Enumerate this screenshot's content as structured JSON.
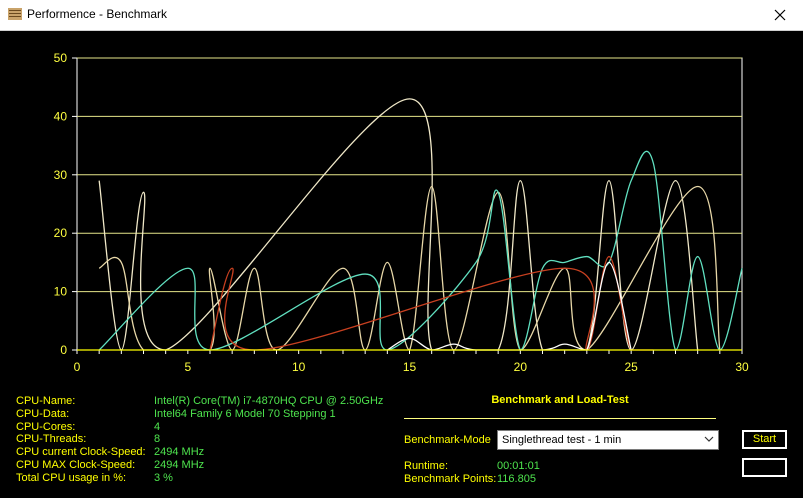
{
  "window": {
    "title": "Performence - Benchmark"
  },
  "chart_data": {
    "type": "line",
    "xlim": [
      0,
      30
    ],
    "ylim": [
      0,
      50
    ],
    "x_ticks": [
      0,
      5,
      10,
      15,
      20,
      25,
      30
    ],
    "y_ticks": [
      0,
      10,
      20,
      30,
      40,
      50
    ],
    "grid": "horizontal",
    "series": [
      {
        "color": "#f0e8c8",
        "points": [
          [
            1,
            29
          ],
          [
            2,
            0
          ],
          [
            3,
            27
          ],
          [
            4,
            0
          ],
          [
            15,
            43
          ],
          [
            16,
            0
          ],
          [
            19,
            0
          ],
          [
            20,
            29
          ],
          [
            21,
            0
          ],
          [
            23,
            0
          ],
          [
            24,
            29
          ],
          [
            25,
            0
          ],
          [
            27,
            29
          ],
          [
            28,
            0
          ]
        ]
      },
      {
        "color": "#e8d8a8",
        "points": [
          [
            1,
            14
          ],
          [
            2,
            15
          ],
          [
            3,
            0
          ],
          [
            6,
            0
          ],
          [
            6,
            14
          ],
          [
            7,
            0
          ],
          [
            8,
            14
          ],
          [
            9,
            0
          ],
          [
            12,
            14
          ],
          [
            13,
            0
          ],
          [
            14,
            15
          ],
          [
            15,
            0
          ],
          [
            16,
            28
          ],
          [
            17,
            0
          ],
          [
            19,
            27
          ],
          [
            20,
            0
          ],
          [
            22,
            14
          ],
          [
            23,
            0
          ],
          [
            28,
            28
          ],
          [
            29,
            0
          ]
        ]
      },
      {
        "color": "#60e0c0",
        "points": [
          [
            1,
            0
          ],
          [
            5,
            14
          ],
          [
            6,
            0
          ],
          [
            13,
            13
          ],
          [
            14,
            0
          ],
          [
            18,
            15
          ],
          [
            19,
            27
          ],
          [
            20,
            0
          ],
          [
            21,
            14
          ],
          [
            22,
            15
          ],
          [
            23,
            16
          ],
          [
            24,
            15
          ],
          [
            25,
            29
          ],
          [
            26,
            32
          ],
          [
            27,
            0
          ],
          [
            28,
            16
          ],
          [
            29,
            0
          ],
          [
            30,
            14
          ]
        ]
      },
      {
        "color": "#c84020",
        "points": [
          [
            6,
            0
          ],
          [
            7,
            14
          ],
          [
            8,
            0
          ],
          [
            22,
            14
          ],
          [
            23,
            0
          ],
          [
            24,
            16
          ],
          [
            25,
            0
          ],
          [
            26,
            0
          ]
        ]
      },
      {
        "color": "#ffffff",
        "points": [
          [
            14,
            0
          ],
          [
            15,
            2
          ],
          [
            16,
            0
          ],
          [
            17,
            1
          ],
          [
            18,
            0
          ],
          [
            21,
            0
          ],
          [
            22,
            1
          ],
          [
            23,
            0
          ],
          [
            24,
            15
          ],
          [
            25,
            0
          ]
        ]
      },
      {
        "color": "#ffff00",
        "points": [
          [
            0,
            0
          ],
          [
            30,
            0
          ]
        ]
      }
    ]
  },
  "info": {
    "rows": [
      {
        "label": "CPU-Name:",
        "value": "Intel(R) Core(TM) i7-4870HQ CPU @ 2.50GHz"
      },
      {
        "label": "CPU-Data:",
        "value": "Intel64 Family 6 Model 70 Stepping 1"
      },
      {
        "label": "CPU-Cores:",
        "value": "4"
      },
      {
        "label": "CPU-Threads:",
        "value": "8"
      },
      {
        "label": "CPU current Clock-Speed:",
        "value": "2494 MHz"
      },
      {
        "label": "CPU MAX Clock-Speed:",
        "value": "2494 MHz"
      },
      {
        "label": "Total CPU usage in %:",
        "value": "3 %"
      }
    ]
  },
  "bench": {
    "heading": "Benchmark and Load-Test",
    "mode_label": "Benchmark-Mode",
    "mode_value": "Singlethread test - 1 min",
    "runtime_label": "Runtime:",
    "runtime_value": "00:01:01",
    "points_label": "Benchmark Points:",
    "points_value": "116.805",
    "start_label": "Start"
  }
}
